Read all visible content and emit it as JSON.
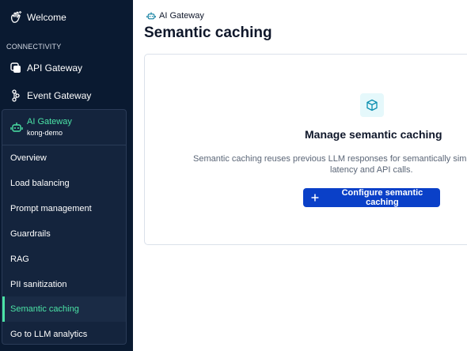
{
  "sidebar": {
    "welcome": "Welcome",
    "section": "CONNECTIVITY",
    "api_gateway": "API Gateway",
    "event_gateway": "Event Gateway",
    "ai_gateway": {
      "title": "AI Gateway",
      "subtitle": "kong-demo",
      "items": [
        {
          "label": "Overview"
        },
        {
          "label": "Load balancing"
        },
        {
          "label": "Prompt management"
        },
        {
          "label": "Guardrails"
        },
        {
          "label": "RAG"
        },
        {
          "label": "PII sanitization"
        },
        {
          "label": "Semantic caching",
          "active": true
        },
        {
          "label": "Go to LLM analytics"
        }
      ]
    }
  },
  "main": {
    "breadcrumb": "AI Gateway",
    "title": "Semantic caching",
    "empty": {
      "icon": "cube-icon",
      "title": "Manage semantic caching",
      "desc_line1": "Semantic caching reuses previous LLM responses for semantically simil",
      "desc_line2": "latency and API calls.",
      "button": "Configure semantic caching"
    }
  },
  "colors": {
    "sidebar_bg": "#0a1a31",
    "accent_green": "#4be3a6",
    "primary_button": "#0a40c8"
  }
}
